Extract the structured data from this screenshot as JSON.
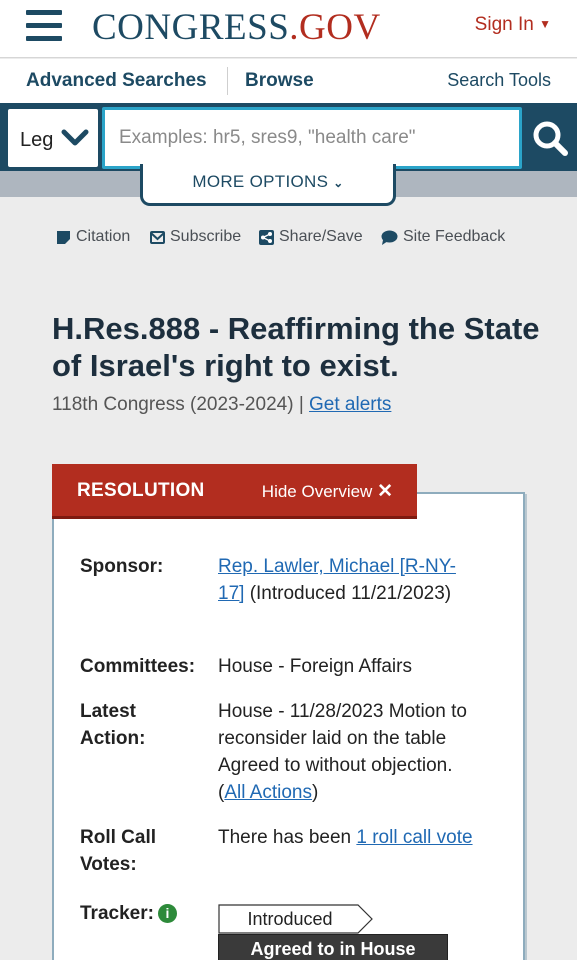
{
  "header": {
    "logo_main": "CONGRESS",
    "logo_dot": ".",
    "logo_gov": "GOV",
    "sign_in": "Sign In"
  },
  "subnav": {
    "advanced_searches": "Advanced Searches",
    "browse": "Browse",
    "search_tools": "Search Tools"
  },
  "search": {
    "collection_selected": "Leg",
    "placeholder": "Examples: hr5, sres9, \"health care\"",
    "more_options": "MORE OPTIONS"
  },
  "tools": {
    "citation": "Citation",
    "subscribe": "Subscribe",
    "share_save": "Share/Save",
    "site_feedback": "Site Feedback"
  },
  "bill": {
    "title": "H.Res.888 - Reaffirming the State of Israel's right to exist.",
    "congress": "118th Congress (2023-2024)",
    "separator": "|",
    "get_alerts": "Get alerts"
  },
  "overview": {
    "type_label": "RESOLUTION",
    "hide_overview": "Hide Overview",
    "sponsor_label": "Sponsor:",
    "sponsor_link": "Rep. Lawler, Michael [R-NY-17]",
    "sponsor_note": "(Introduced 11/21/2023)",
    "committees_label": "Committees:",
    "committees_value": "House - Foreign Affairs",
    "latest_action_label": "Latest Action:",
    "latest_action_text": "House - 11/28/2023 Motion to reconsider laid on the table Agreed to without objection.",
    "all_actions": "All Actions",
    "roll_call_label": "Roll Call Votes:",
    "roll_call_text": "There has been",
    "roll_call_link": "1 roll call vote",
    "tracker_label": "Tracker:",
    "tracker_steps": [
      "Introduced",
      "Agreed to in House"
    ]
  }
}
